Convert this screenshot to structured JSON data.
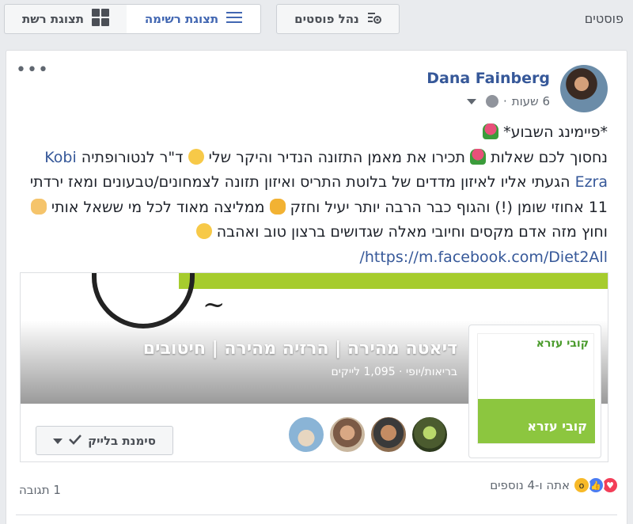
{
  "toolbar": {
    "posts_label": "פוסטים",
    "manage_posts": "נהל פוסטים",
    "list_view": "תצוגת רשימה",
    "grid_view": "תצוגת רשת"
  },
  "post": {
    "author": "Dana Fainberg",
    "time": "6 שעות",
    "more": "•••",
    "lines": {
      "l1": "*פיימינג השבוע*",
      "l2_a": "נחסוך לכם שאלות",
      "l2_b": " תכירו את מאמן התזונה הנדיר והיקר שלי",
      "l2_c": " ד\"ר לנטורופתיה ",
      "name1": "Kobi",
      "name2": "Ezra",
      "l3": " הגעתי אליו לאיזון מדדים של בלוטת התריס ואיזון תזונה לצמחונים/טבעונים ומאז ירדתי 11 אחוזי שומן (!) והגוף כבר הרבה יותר יעיל וחזק",
      "l4_a": "ממליצה מאוד לכל מי ששאל אותי",
      "l4_b": " וחוץ מזה אדם מקסים וחיובי מאלה שגדושים ברצון טוב ואהבה",
      "link": "https://m.facebook.com/Diet2All/"
    }
  },
  "preview": {
    "page_title": "דיאטה מהירה | הרזיה מהירה | חיטובים",
    "page_sub": "בריאות/יופי · 1,095 לייקים",
    "like_button": "סימנת בלייק",
    "card_name": "קובי עזרא",
    "card_name2": "קובי עזרא"
  },
  "footer": {
    "reactions_text": "אתה ו-4 נוספים",
    "comments": "1 תגובה"
  },
  "colors": {
    "link": "#365899",
    "accent_green": "#8cc63f",
    "love": "#f33e58",
    "like": "#4a7cf2"
  }
}
